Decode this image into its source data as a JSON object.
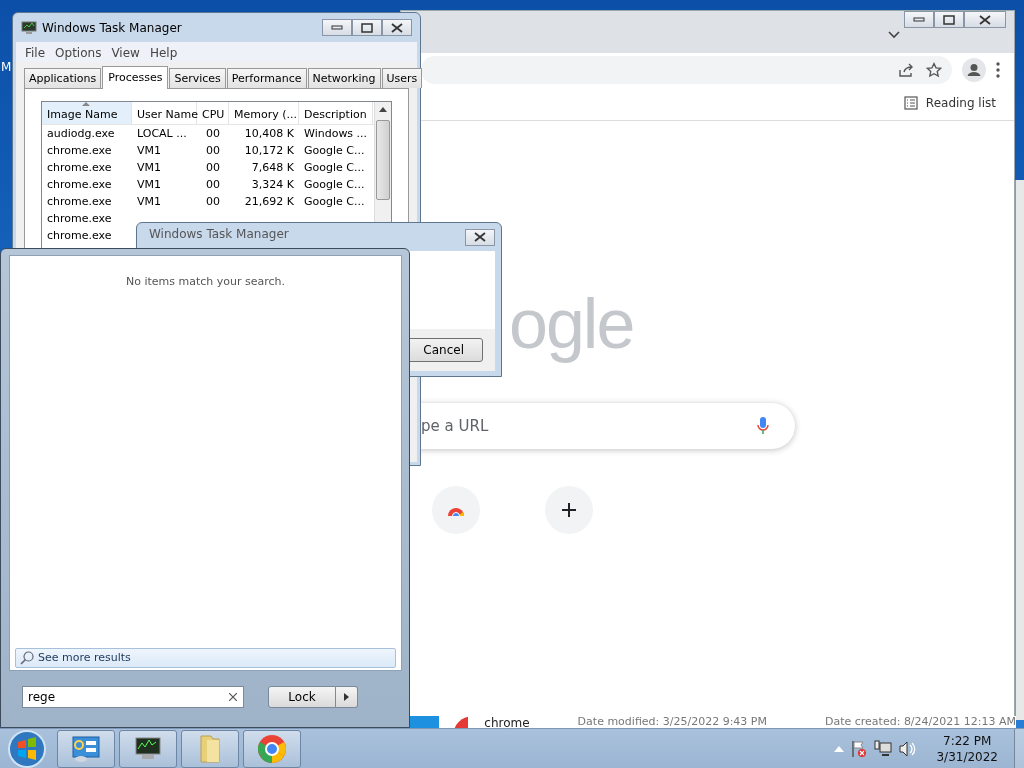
{
  "desktop": {
    "icon_label": "M"
  },
  "browser": {
    "reading_list": "Reading list",
    "logo_text": "ogle",
    "search": {
      "placeholder": "pe a URL"
    }
  },
  "explorer_result": {
    "name": "chrome",
    "modified": "Date modified: 3/25/2022 9:43 PM",
    "created": "Date created: 8/24/2021 12:13 AM"
  },
  "task_manager": {
    "title": "Windows Task Manager",
    "menu": [
      "File",
      "Options",
      "View",
      "Help"
    ],
    "tabs": [
      {
        "label": "Applications",
        "selected": false
      },
      {
        "label": "Processes",
        "selected": true
      },
      {
        "label": "Services",
        "selected": false
      },
      {
        "label": "Performance",
        "selected": false
      },
      {
        "label": "Networking",
        "selected": false
      },
      {
        "label": "Users",
        "selected": false
      }
    ],
    "columns": [
      {
        "label": "Image Name",
        "sorted": true
      },
      {
        "label": "User Name",
        "sorted": false
      },
      {
        "label": "CPU",
        "sorted": false
      },
      {
        "label": "Memory (...",
        "sorted": false
      },
      {
        "label": "Description",
        "sorted": false
      }
    ],
    "rows": [
      [
        "audiodg.exe",
        "LOCAL ...",
        "00",
        "10,408 K",
        "Windows ..."
      ],
      [
        "chrome.exe",
        "VM1",
        "00",
        "10,172 K",
        "Google C..."
      ],
      [
        "chrome.exe",
        "VM1",
        "00",
        "7,648 K",
        "Google C..."
      ],
      [
        "chrome.exe",
        "VM1",
        "00",
        "3,324 K",
        "Google C..."
      ],
      [
        "chrome.exe",
        "VM1",
        "00",
        "21,692 K",
        "Google C..."
      ],
      [
        "chrome.exe"
      ],
      [
        "chrome.exe"
      ]
    ]
  },
  "dialog": {
    "title": "Windows Task Manager",
    "button": "Cancel"
  },
  "start_menu": {
    "message": "No items match your search.",
    "see_more": "See more results",
    "search": {
      "value": "rege"
    },
    "power_button": "Lock"
  },
  "taskbar": {
    "clock": {
      "time": "7:22 PM",
      "date": "3/31/2022"
    }
  }
}
